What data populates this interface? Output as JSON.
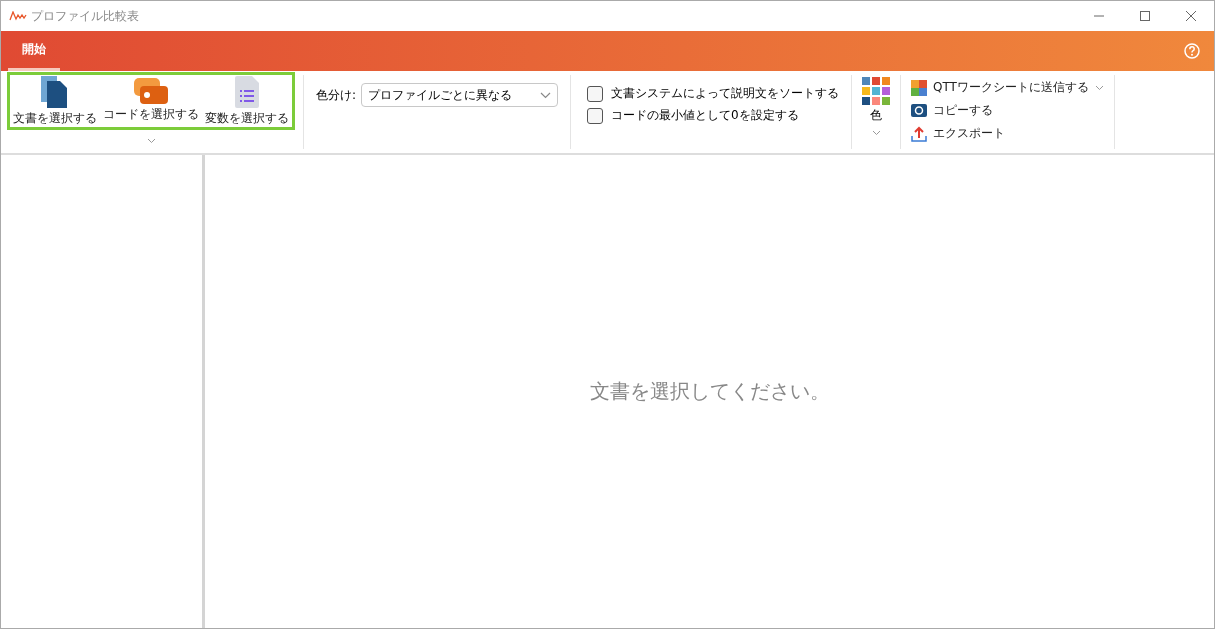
{
  "window": {
    "title": "プロファイル比較表"
  },
  "tabs": [
    {
      "label": "開始",
      "selected": true
    }
  ],
  "ribbon": {
    "select_buttons": [
      {
        "kind": "document",
        "label": "文書を選択する"
      },
      {
        "kind": "code",
        "label": "コードを選択する"
      },
      {
        "kind": "variable",
        "label": "変数を選択する"
      }
    ],
    "color_by": {
      "label": "色分け:",
      "value": "プロファイルごとに異なる"
    },
    "options": [
      {
        "label": "文書システムによって説明文をソートする",
        "checked": false
      },
      {
        "label": "コードの最小値として0を設定する",
        "checked": false
      }
    ],
    "color_button": {
      "label": "色"
    },
    "actions": [
      {
        "kind": "qtt",
        "label": "QTTワークシートに送信する"
      },
      {
        "kind": "copy",
        "label": "コピーする"
      },
      {
        "kind": "export",
        "label": "エクスポート"
      }
    ]
  },
  "main": {
    "message": "文書を選択してください。"
  }
}
